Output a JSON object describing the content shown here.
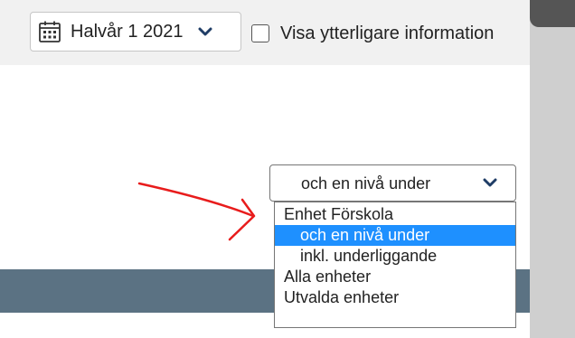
{
  "toolbar": {
    "period": {
      "icon": "calendar-icon",
      "label": "Halvår 1 2021",
      "chevron": "chevron-down-icon"
    },
    "more_info": {
      "label": "Visa ytterligare information",
      "checked": false
    }
  },
  "level_select": {
    "selected_label": "och en nivå under",
    "chevron": "chevron-down-icon",
    "options": [
      {
        "label": "Enhet Förskola",
        "selected": false
      },
      {
        "label": "och en nivå under",
        "selected": true
      },
      {
        "label": "inkl. underliggande",
        "selected": false
      },
      {
        "label": "Alla enheter",
        "selected": false
      },
      {
        "label": "Utvalda enheter",
        "selected": false
      }
    ]
  },
  "colors": {
    "toolbar_bg": "#f1f1f1",
    "band": "#5b7283",
    "option_highlight": "#1e90ff",
    "annotation_arrow": "#e81c1c"
  }
}
